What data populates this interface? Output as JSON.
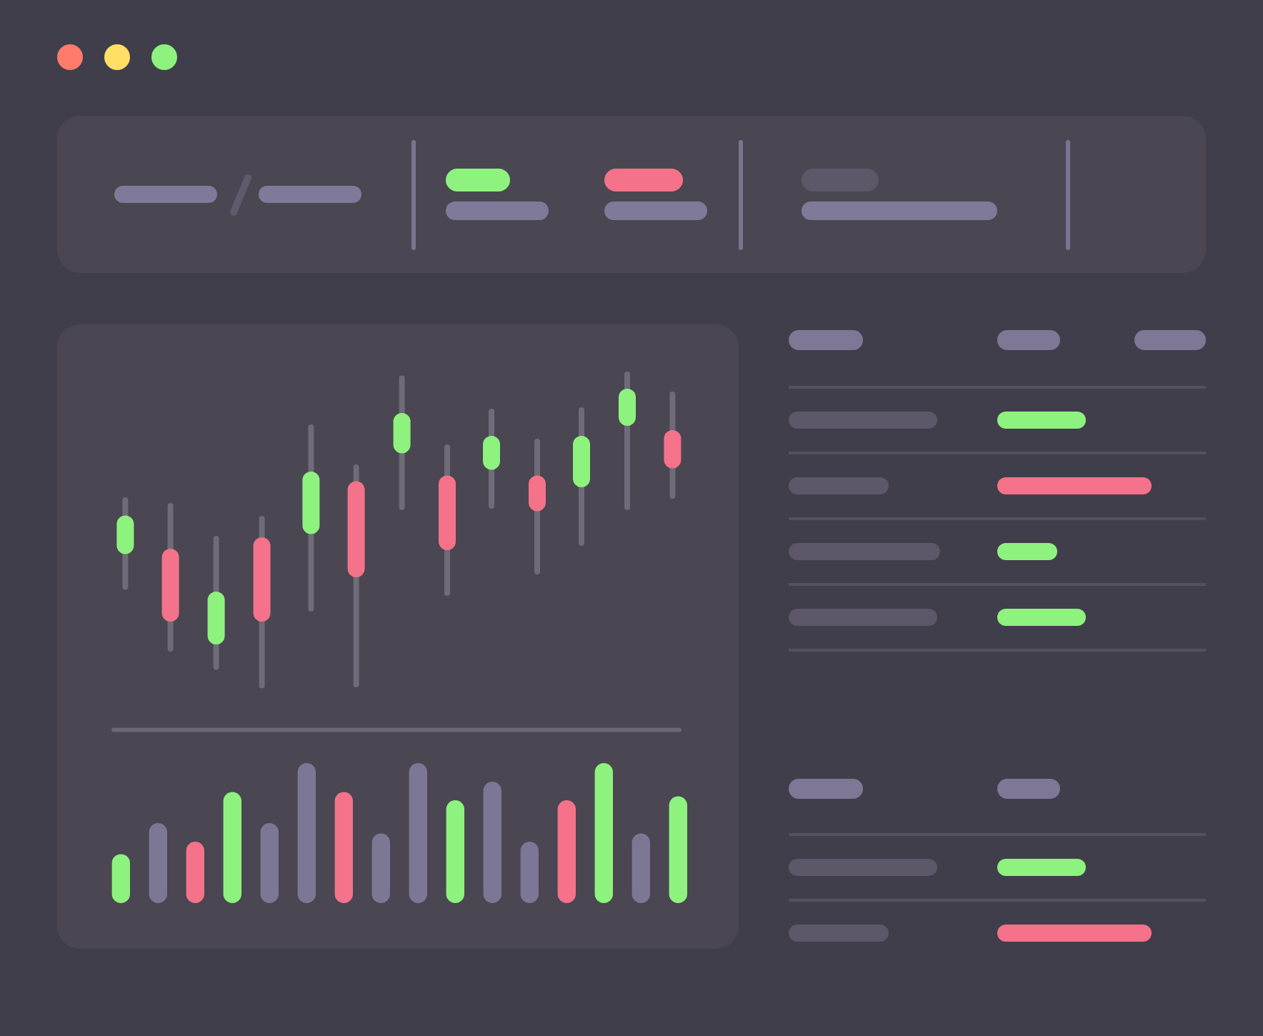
{
  "window": {
    "buttons": [
      {
        "color": "#ff7b6b"
      },
      {
        "color": "#ffdf66"
      },
      {
        "color": "#8ef27e"
      }
    ]
  },
  "summary": {
    "stats": [
      {
        "color": "#8ef27e"
      },
      {
        "color": "#f4738a"
      },
      {
        "color": "#5c5769"
      }
    ]
  },
  "chart": {
    "candles": [
      {
        "color": "#8ef27e"
      },
      {
        "color": "#f4738a"
      },
      {
        "color": "#8ef27e"
      },
      {
        "color": "#f4738a"
      },
      {
        "color": "#8ef27e"
      },
      {
        "color": "#f4738a"
      },
      {
        "color": "#8ef27e"
      },
      {
        "color": "#f4738a"
      },
      {
        "color": "#8ef27e"
      },
      {
        "color": "#f4738a"
      },
      {
        "color": "#8ef27e"
      },
      {
        "color": "#8ef27e"
      },
      {
        "color": "#f4738a"
      }
    ],
    "volume_bars": [
      {
        "color": "#8ef27e"
      },
      {
        "color": "#7c7794"
      },
      {
        "color": "#f4738a"
      },
      {
        "color": "#8ef27e"
      },
      {
        "color": "#7c7794"
      },
      {
        "color": "#7c7794"
      },
      {
        "color": "#f4738a"
      },
      {
        "color": "#7c7794"
      },
      {
        "color": "#7c7794"
      },
      {
        "color": "#8ef27e"
      },
      {
        "color": "#7c7794"
      },
      {
        "color": "#7c7794"
      },
      {
        "color": "#f4738a"
      },
      {
        "color": "#8ef27e"
      },
      {
        "color": "#7c7794"
      },
      {
        "color": "#8ef27e"
      }
    ]
  },
  "tables": [
    {
      "rows": [
        {
          "color": "#8ef27e"
        },
        {
          "color": "#f4738a"
        },
        {
          "color": "#8ef27e"
        },
        {
          "color": "#8ef27e"
        }
      ]
    },
    {
      "rows": [
        {
          "color": "#8ef27e"
        },
        {
          "color": "#f4738a"
        }
      ]
    }
  ]
}
